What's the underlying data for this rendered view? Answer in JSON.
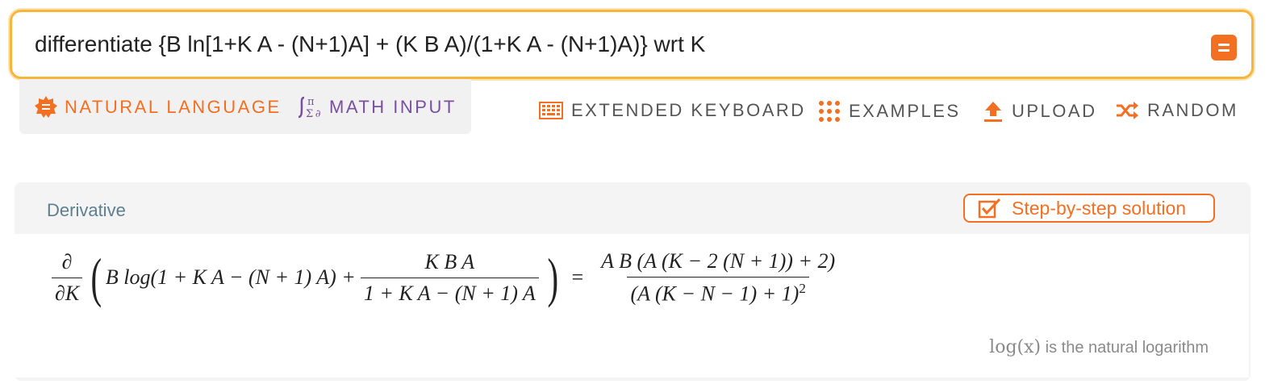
{
  "search": {
    "query": "differentiate {B ln[1+K A - (N+1)A] + (K B A)/(1+K A - (N+1)A)} wrt K"
  },
  "modes": {
    "natural_language": "NATURAL LANGUAGE",
    "math_input": "MATH INPUT"
  },
  "toolbar": {
    "extended_keyboard": "EXTENDED KEYBOARD",
    "examples": "EXAMPLES",
    "upload": "UPLOAD",
    "random": "RANDOM"
  },
  "pod": {
    "title": "Derivative",
    "step_button": "Step-by-step solution",
    "formula": {
      "d_num": "∂",
      "d_den": "∂K",
      "term1": "B log(1 + K A − (N + 1) A) +",
      "frac_num": "K B A",
      "frac_den": "1 + K A − (N + 1) A",
      "equals": "=",
      "rhs_num": "A B (A (K − 2 (N + 1)) + 2)",
      "rhs_den": "(A (K − N − 1) + 1)",
      "rhs_den_exp": "2"
    },
    "note_math": "log(x)",
    "note_text": " is the natural logarithm"
  },
  "colors": {
    "accent": "#f36f21",
    "search_border": "#f7b53d",
    "math_input": "#7a4fa0",
    "pod_title": "#5e7f8f"
  },
  "icons": {
    "equals_button": "equals-icon",
    "natural_language": "sun-badge-icon",
    "math_input": "integral-pi-sigma-icon",
    "extended_keyboard": "keyboard-icon",
    "examples": "dots-grid-icon",
    "upload": "upload-arrow-icon",
    "random": "shuffle-icon",
    "step_by_step": "checkbox-icon"
  }
}
